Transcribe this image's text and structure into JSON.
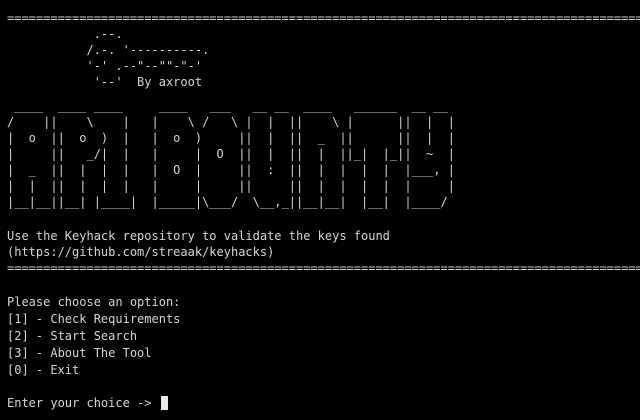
{
  "terminal": {
    "separator_top": "=========================================================================================",
    "key_art": "            .--.\n           /.-. '----------.\n           '-' .--\"--\"\"-\"-'\n            '--'  By axroot",
    "banner_art": " ____  ____ ____     ____   ___   __ __  ____   ______  __ __\n/    ||    \\    |   |    \\ /   \\ |  |  ||    \\ |      ||  |  |\n|  o  ||  o  )  |   |  o  )     ||  |  ||  _  ||      ||  |  |\n|     ||   _/|  |   |     |  O  ||  |  ||  |  ||_|  |_||  ~  |\n|  _  ||  |  |  |   |  O  |     ||  :  ||  |  |  |  |  |___, |\n|  |  ||  |  |  |   |     |     ||     ||  |  |  |  |  |     |\n|__|__||__| |____|  |_____|\\___/  \\__,_||__|__|  |__|  |____/",
    "info_line": "Use the Keyhack repository to validate the keys found",
    "info_url": "(https://github.com/streaak/keyhacks)",
    "separator_bottom": "=========================================================================================",
    "menu_prompt": "Please choose an option:",
    "options": [
      "[1] - Check Requirements",
      "[2] - Start Search",
      "[3] - About The Tool",
      "[0] - Exit"
    ],
    "input_prompt": "Enter your choice -> "
  }
}
